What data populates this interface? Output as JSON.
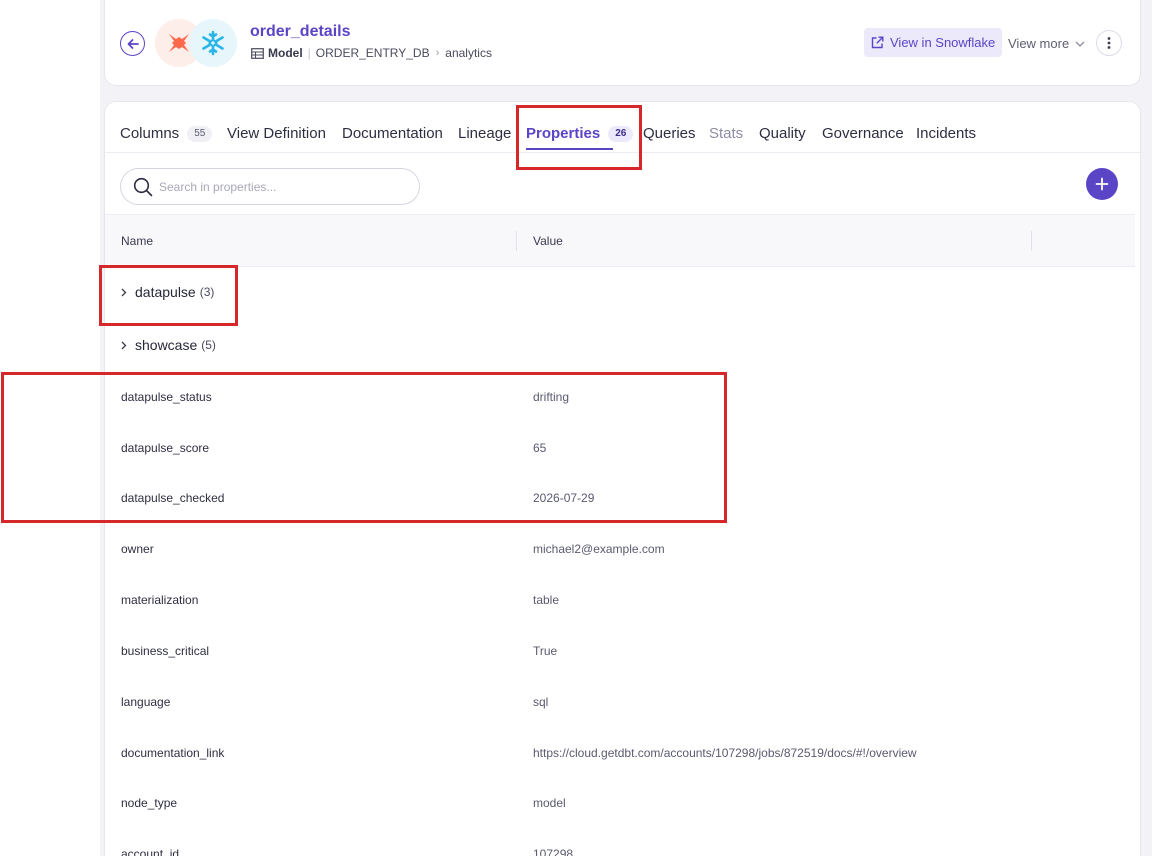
{
  "header": {
    "title": "order_details",
    "type_label": "Model",
    "database": "ORDER_ENTRY_DB",
    "schema": "analytics",
    "view_in_snowflake": "View in Snowflake",
    "view_more": "View more"
  },
  "tabs": [
    {
      "label": "Columns",
      "count": "55"
    },
    {
      "label": "View Definition"
    },
    {
      "label": "Documentation"
    },
    {
      "label": "Lineage"
    },
    {
      "label": "Properties",
      "count": "26"
    },
    {
      "label": "Queries"
    },
    {
      "label": "Stats"
    },
    {
      "label": "Quality"
    },
    {
      "label": "Governance"
    },
    {
      "label": "Incidents"
    }
  ],
  "search": {
    "placeholder": "Search in properties..."
  },
  "table": {
    "columns": [
      "Name",
      "Value"
    ],
    "groups": [
      {
        "name": "datapulse",
        "count": "(3)"
      },
      {
        "name": "showcase",
        "count": "(5)"
      }
    ],
    "rows": [
      {
        "name": "datapulse_status",
        "value": "drifting"
      },
      {
        "name": "datapulse_score",
        "value": "65"
      },
      {
        "name": "datapulse_checked",
        "value": "2026-07-29"
      },
      {
        "name": "owner",
        "value": "michael2@example.com"
      },
      {
        "name": "materialization",
        "value": "table"
      },
      {
        "name": "business_critical",
        "value": "True"
      },
      {
        "name": "language",
        "value": "sql"
      },
      {
        "name": "documentation_link",
        "value": "https://cloud.getdbt.com/accounts/107298/jobs/872519/docs/#!/overview"
      },
      {
        "name": "node_type",
        "value": "model"
      },
      {
        "name": "account_id",
        "value": "107298"
      }
    ]
  },
  "colors": {
    "accent": "#5b45c7",
    "highlight": "#d6272b",
    "dbt": "#ff694b",
    "snowflake": "#29b5e8"
  }
}
